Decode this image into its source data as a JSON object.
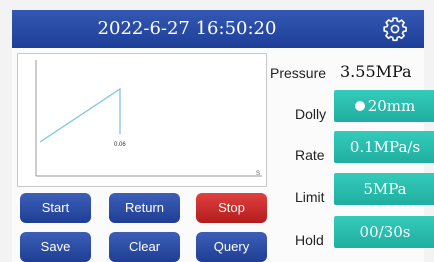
{
  "header": {
    "datetime": "2022-6-27 16:50:20",
    "settings_icon": "gear-icon"
  },
  "graph": {
    "peak_label": "0.06",
    "x_axis_label": "S"
  },
  "buttons": {
    "start": "Start",
    "return": "Return",
    "stop": "Stop",
    "save": "Save",
    "clear": "Clear",
    "query": "Query"
  },
  "params": {
    "pressure_label": "Pressure",
    "pressure_value": "3.55MPa",
    "dolly_label": "Dolly",
    "dolly_value": "20mm",
    "rate_label": "Rate",
    "rate_value": "0.1MPa/s",
    "limit_label": "Limit",
    "limit_value": "5MPa",
    "hold_label": "Hold",
    "hold_value": "00/30s"
  },
  "colors": {
    "header_blue": "#1e3f98",
    "button_blue": "#2a4aa6",
    "button_red": "#cc2a2a",
    "value_teal": "#2cbcae",
    "graph_line": "#7ec6e6"
  }
}
